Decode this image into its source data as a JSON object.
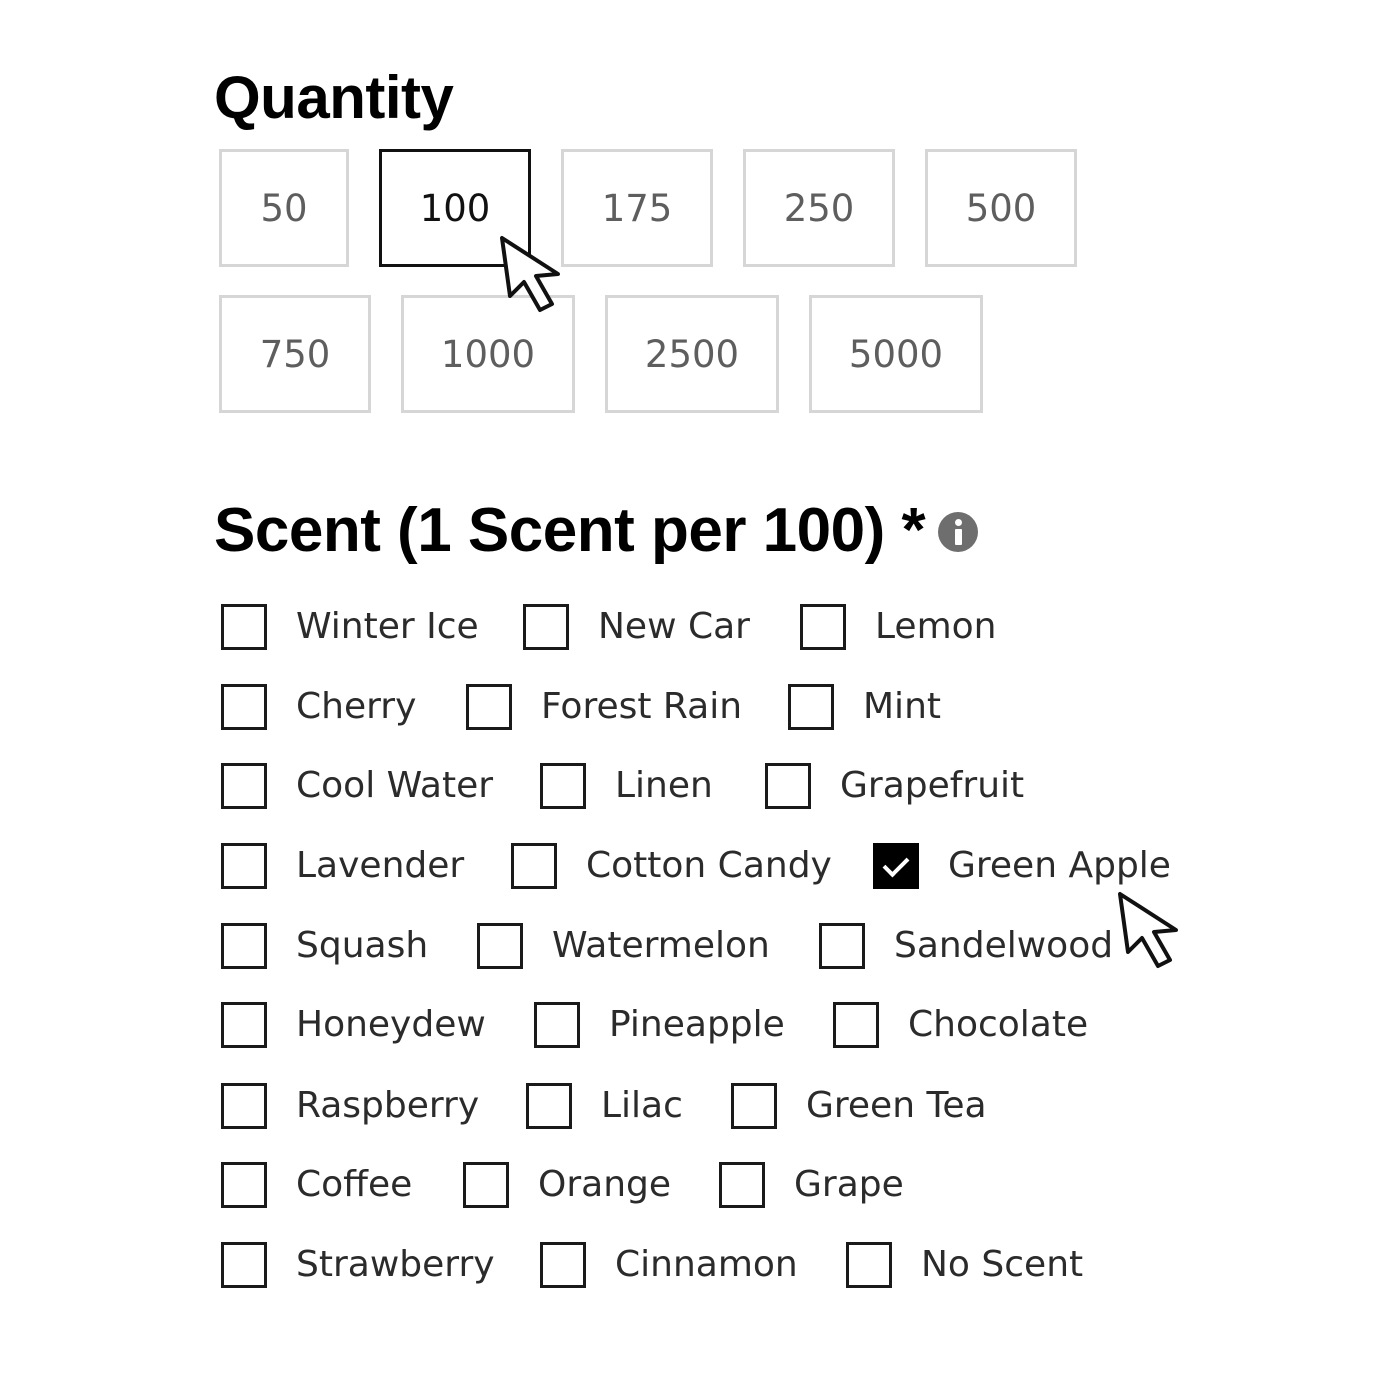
{
  "quantity": {
    "title": "Quantity",
    "options_row1": [
      "50",
      "100",
      "175",
      "250",
      "500"
    ],
    "options_row2": [
      "750",
      "1000",
      "2500",
      "5000"
    ],
    "selected": "100"
  },
  "scent": {
    "title": "Scent (1 Scent per 100) *",
    "info_icon": "info-circle-icon",
    "rows": [
      [
        {
          "label": "Winter Ice",
          "checked": false
        },
        {
          "label": "New Car",
          "checked": false
        },
        {
          "label": "Lemon",
          "checked": false
        }
      ],
      [
        {
          "label": "Cherry",
          "checked": false
        },
        {
          "label": "Forest Rain",
          "checked": false
        },
        {
          "label": "Mint",
          "checked": false
        }
      ],
      [
        {
          "label": "Cool Water",
          "checked": false
        },
        {
          "label": "Linen",
          "checked": false
        },
        {
          "label": "Grapefruit",
          "checked": false
        }
      ],
      [
        {
          "label": "Lavender",
          "checked": false
        },
        {
          "label": "Cotton Candy",
          "checked": false
        },
        {
          "label": "Green Apple",
          "checked": true
        }
      ],
      [
        {
          "label": "Squash",
          "checked": false
        },
        {
          "label": "Watermelon",
          "checked": false
        },
        {
          "label": "Sandelwood",
          "checked": false
        }
      ],
      [
        {
          "label": "Honeydew",
          "checked": false
        },
        {
          "label": "Pineapple",
          "checked": false
        },
        {
          "label": "Chocolate",
          "checked": false
        }
      ],
      [
        {
          "label": "Raspberry",
          "checked": false
        },
        {
          "label": "Lilac",
          "checked": false
        },
        {
          "label": "Green Tea",
          "checked": false
        }
      ],
      [
        {
          "label": "Coffee",
          "checked": false
        },
        {
          "label": "Orange",
          "checked": false
        },
        {
          "label": "Grape",
          "checked": false
        }
      ],
      [
        {
          "label": "Strawberry",
          "checked": false
        },
        {
          "label": "Cinnamon",
          "checked": false
        },
        {
          "label": "No Scent",
          "checked": false
        }
      ]
    ]
  },
  "colors": {
    "selected_border": "#111111",
    "unselected_border": "#d6d6d6",
    "checked_fill": "#000000"
  }
}
